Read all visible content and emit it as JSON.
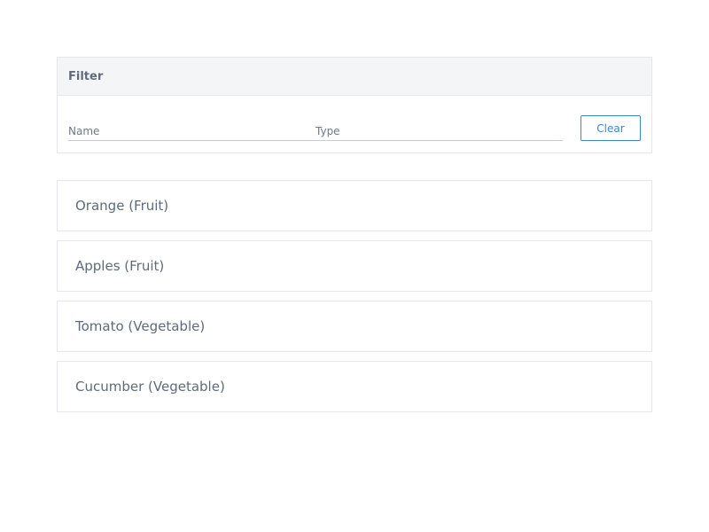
{
  "filter": {
    "title": "Filter",
    "name_placeholder": "Name",
    "type_placeholder": "Type",
    "clear_label": "Clear"
  },
  "items": [
    {
      "label": "Orange (Fruit)"
    },
    {
      "label": "Apples (Fruit)"
    },
    {
      "label": "Tomato (Vegetable)"
    },
    {
      "label": "Cucumber (Vegetable)"
    }
  ],
  "colors": {
    "accent": "#3f86c6",
    "border": "#e3e6ea",
    "header_bg": "#f4f5f7",
    "text": "#5f6b7a"
  }
}
